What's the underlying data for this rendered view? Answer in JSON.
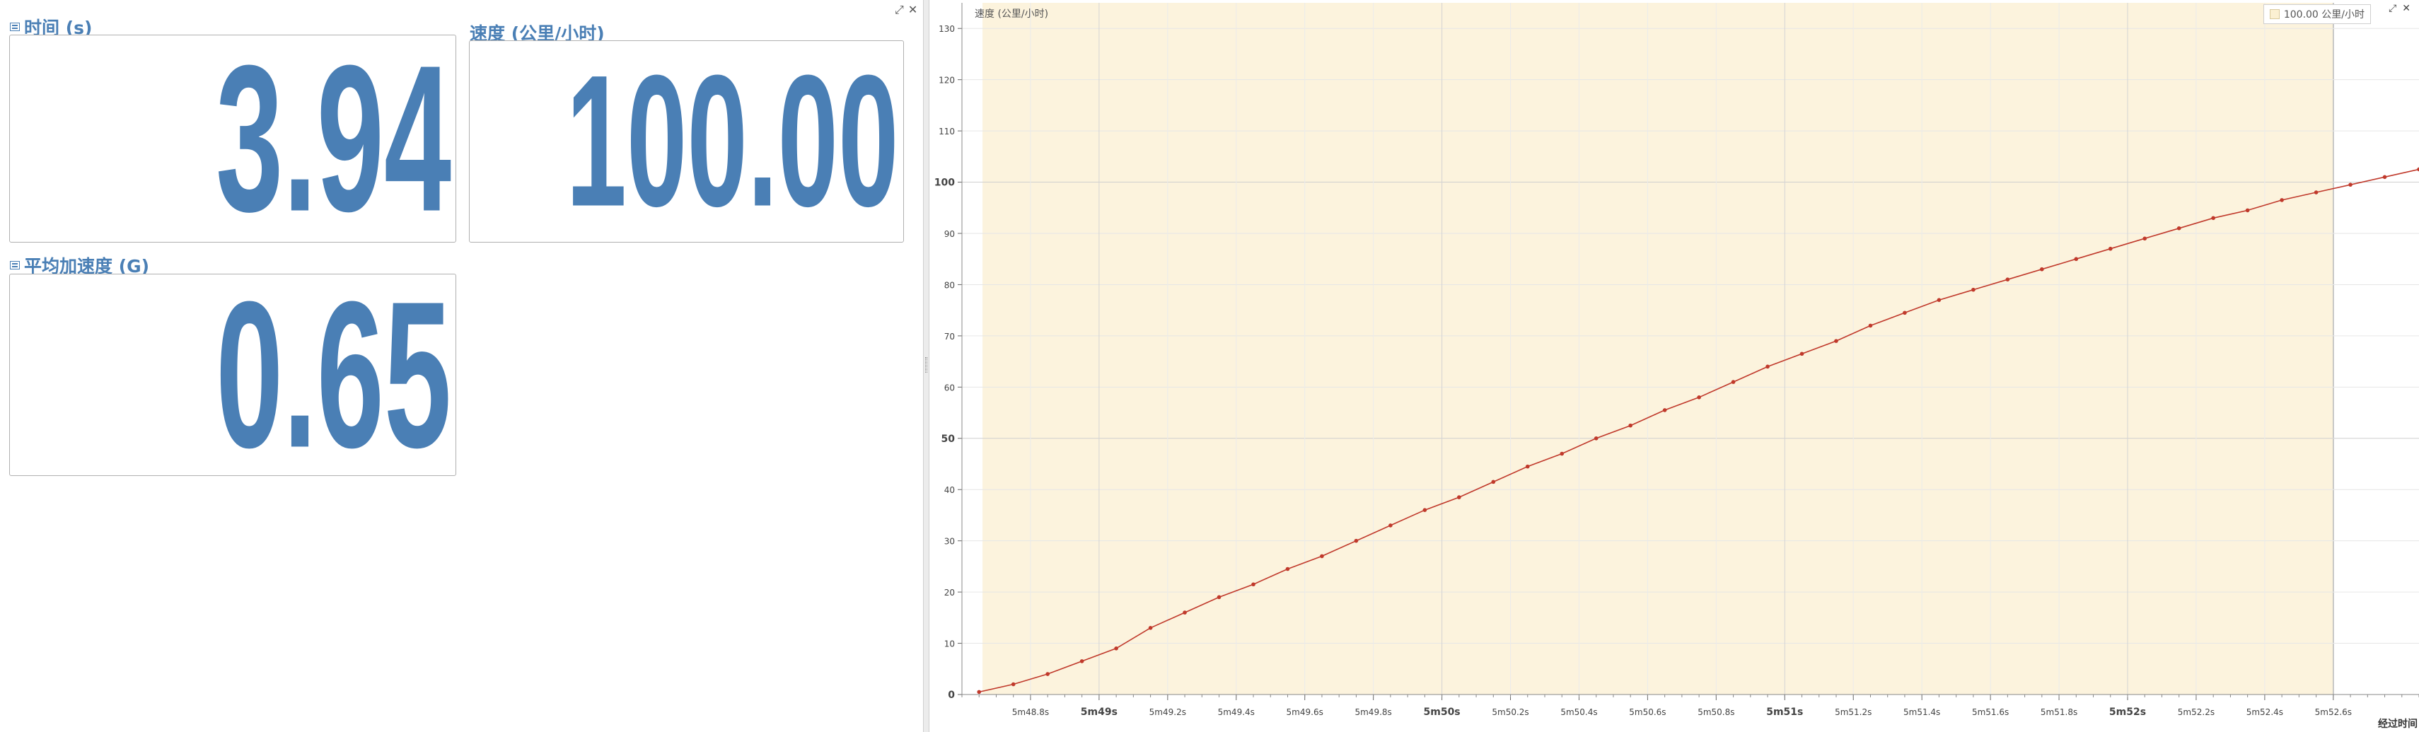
{
  "panels": {
    "time": {
      "title": "时间 (s)",
      "value": "3.94"
    },
    "speed": {
      "title": "速度 (公里/小时)",
      "value": "100.00"
    },
    "accel": {
      "title": "平均加速度 (G)",
      "value": "0.65"
    }
  },
  "window_icons": {
    "expand": "⤢",
    "close": "✕"
  },
  "chart_window_icons": {
    "expand": "⤢",
    "close": "✕"
  },
  "chart_data": {
    "type": "line",
    "title": "速度 (公里/小时)",
    "xlabel": "经过时间",
    "ylabel": "",
    "ylim": [
      0,
      135
    ],
    "y_ticks": [
      0,
      10,
      20,
      30,
      40,
      50,
      60,
      70,
      80,
      90,
      100,
      110,
      120,
      130
    ],
    "xlim": [
      348.6,
      352.85
    ],
    "x_ticks": [
      {
        "x": 348.8,
        "label": "5m48.8s",
        "major": false
      },
      {
        "x": 349.0,
        "label": "5m49s",
        "major": true
      },
      {
        "x": 349.2,
        "label": "5m49.2s",
        "major": false
      },
      {
        "x": 349.4,
        "label": "5m49.4s",
        "major": false
      },
      {
        "x": 349.6,
        "label": "5m49.6s",
        "major": false
      },
      {
        "x": 349.8,
        "label": "5m49.8s",
        "major": false
      },
      {
        "x": 350.0,
        "label": "5m50s",
        "major": true
      },
      {
        "x": 350.2,
        "label": "5m50.2s",
        "major": false
      },
      {
        "x": 350.4,
        "label": "5m50.4s",
        "major": false
      },
      {
        "x": 350.6,
        "label": "5m50.6s",
        "major": false
      },
      {
        "x": 350.8,
        "label": "5m50.8s",
        "major": false
      },
      {
        "x": 351.0,
        "label": "5m51s",
        "major": true
      },
      {
        "x": 351.2,
        "label": "5m51.2s",
        "major": false
      },
      {
        "x": 351.4,
        "label": "5m51.4s",
        "major": false
      },
      {
        "x": 351.6,
        "label": "5m51.6s",
        "major": false
      },
      {
        "x": 351.8,
        "label": "5m51.8s",
        "major": false
      },
      {
        "x": 352.0,
        "label": "5m52s",
        "major": true
      },
      {
        "x": 352.2,
        "label": "5m52.2s",
        "major": false
      },
      {
        "x": 352.4,
        "label": "5m52.4s",
        "major": false
      },
      {
        "x": 352.6,
        "label": "5m52.6s",
        "major": false
      }
    ],
    "selection_start": 348.66,
    "selection_end": 352.6,
    "legend": "100.00 公里/小时",
    "series": [
      {
        "color": "#c0392b",
        "x": [
          348.65,
          348.75,
          348.85,
          348.95,
          349.05,
          349.15,
          349.25,
          349.35,
          349.45,
          349.55,
          349.65,
          349.75,
          349.85,
          349.95,
          350.05,
          350.15,
          350.25,
          350.35,
          350.45,
          350.55,
          350.65,
          350.75,
          350.85,
          350.95,
          351.05,
          351.15,
          351.25,
          351.35,
          351.45,
          351.55,
          351.65,
          351.75,
          351.85,
          351.95,
          352.05,
          352.15,
          352.25,
          352.35,
          352.45,
          352.55,
          352.65,
          352.75,
          352.85
        ],
        "y": [
          0.5,
          2,
          4,
          6.5,
          9,
          13,
          16,
          19,
          21.5,
          24.5,
          27,
          30,
          33,
          36,
          38.5,
          41.5,
          44.5,
          47,
          50,
          52.5,
          55.5,
          58,
          61,
          64,
          66.5,
          69,
          72,
          74.5,
          77,
          79,
          81,
          83,
          85,
          87,
          89,
          91,
          93,
          94.5,
          96.5,
          98,
          99.5,
          101,
          102.5
        ]
      }
    ]
  }
}
